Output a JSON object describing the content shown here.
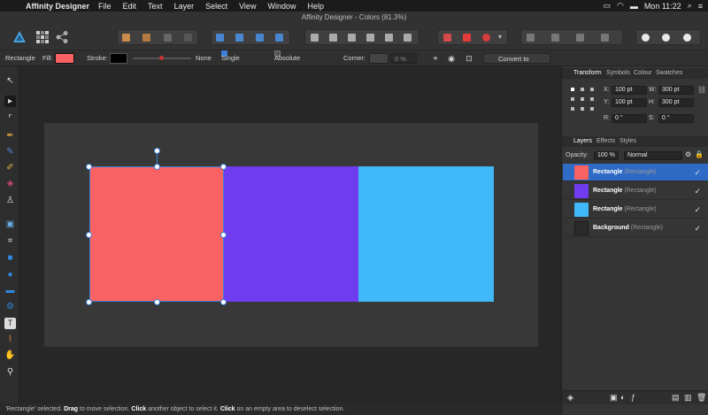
{
  "menubar": {
    "app_name": "Affinity Designer",
    "items": [
      "File",
      "Edit",
      "Text",
      "Layer",
      "Select",
      "View",
      "Window",
      "Help"
    ],
    "clock": "Mon 11:22"
  },
  "window": {
    "title": "Affinity Designer - Colors (81.3%)"
  },
  "context_toolbar": {
    "object_label": "Rectangle",
    "fill_label": "Fill:",
    "fill_color": "#f86262",
    "stroke_label": "Stroke:",
    "stroke_style": "None",
    "single_radius_label": "Single radius",
    "absolute_sizes_label": "Absolute sizes",
    "corner_label": "Corner:",
    "corner_value": "0 %",
    "convert_label": "Convert to Curves"
  },
  "transform_panel": {
    "tabs": [
      "Transform",
      "Symbols",
      "Colour",
      "Swatches"
    ],
    "x_label": "X:",
    "x_value": "100 pt",
    "w_label": "W:",
    "w_value": "300 pt",
    "y_label": "Y:",
    "y_value": "100 pt",
    "h_label": "H:",
    "h_value": "300 pt",
    "r_label": "R:",
    "r_value": "0 °",
    "s_label": "S:",
    "s_value": "0 °"
  },
  "layers_panel": {
    "tabs": [
      "Layers",
      "Effects",
      "Styles"
    ],
    "opacity_label": "Opacity:",
    "opacity_value": "100 %",
    "blend_mode": "Normal",
    "items": [
      {
        "name": "Rectangle",
        "type": "(Rectangle)",
        "color": "#f86262",
        "selected": true
      },
      {
        "name": "Rectangle",
        "type": "(Rectangle)",
        "color": "#6f3cf0",
        "selected": false
      },
      {
        "name": "Rectangle",
        "type": "(Rectangle)",
        "color": "#41b8f8",
        "selected": false
      },
      {
        "name": "Background",
        "type": "(Rectangle)",
        "color": "#2a2a2a",
        "selected": false
      }
    ]
  },
  "canvas": {
    "shapes": [
      {
        "name": "red-rectangle",
        "color": "#f86262"
      },
      {
        "name": "purple-rectangle",
        "color": "#6f3cf0"
      },
      {
        "name": "blue-rectangle",
        "color": "#41b8f8"
      }
    ]
  },
  "status_bar": {
    "quote": "'Rectangle' selected.",
    "drag": "Drag",
    "drag_text": "to move selection.",
    "click1": "Click",
    "click1_text": "another object to select it.",
    "click2": "Click",
    "click2_text": "on an empty area to deselect selection."
  },
  "colors": {
    "accent": "#3d7fd6",
    "selection_row": "#2f6ac4"
  }
}
